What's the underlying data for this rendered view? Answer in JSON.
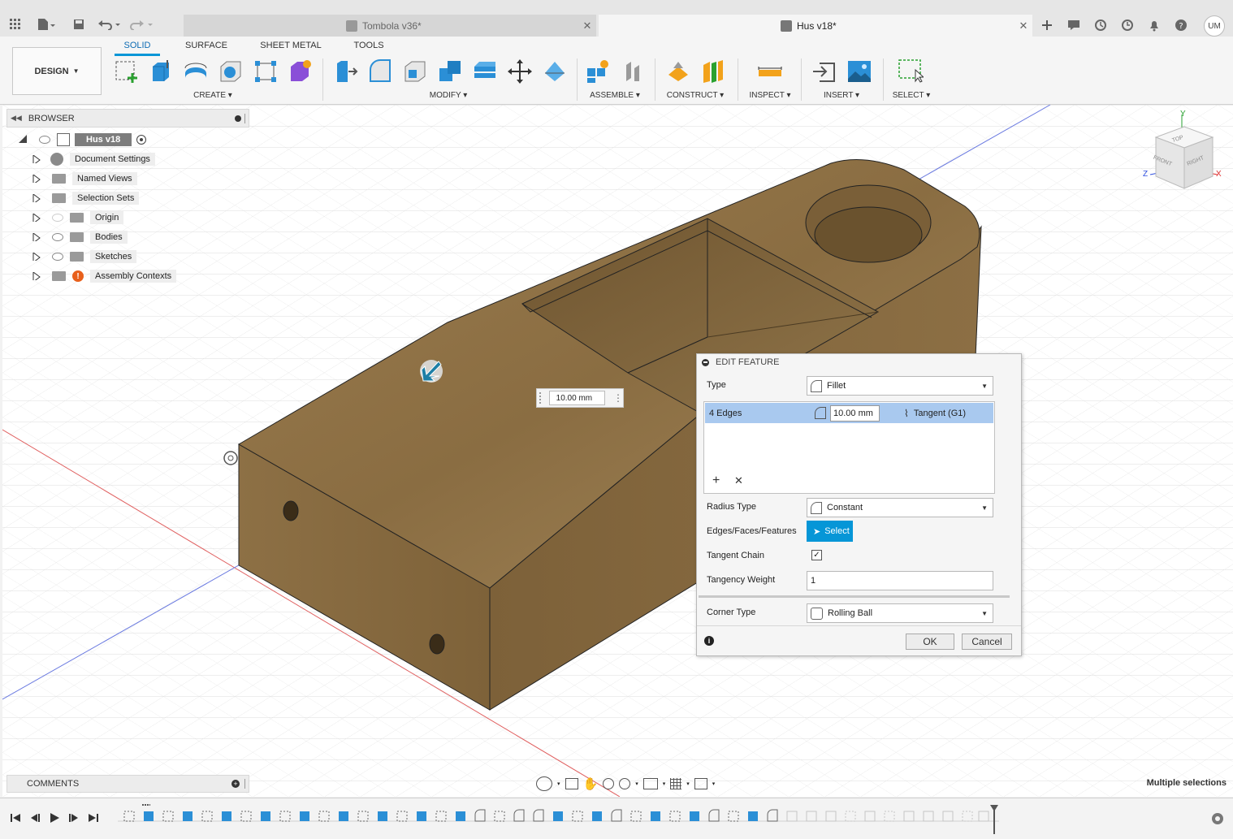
{
  "tabs": [
    {
      "label": "Tombola v36*"
    },
    {
      "label": "Hus v18*"
    }
  ],
  "user": {
    "initials": "UM"
  },
  "design_button": {
    "label": "DESIGN"
  },
  "workspace_tabs": [
    {
      "label": "SOLID"
    },
    {
      "label": "SURFACE"
    },
    {
      "label": "SHEET METAL"
    },
    {
      "label": "TOOLS"
    }
  ],
  "groups": {
    "create": "CREATE",
    "modify": "MODIFY",
    "assemble": "ASSEMBLE",
    "construct": "CONSTRUCT",
    "inspect": "INSPECT",
    "insert": "INSERT",
    "select": "SELECT"
  },
  "browser": {
    "title": "BROWSER",
    "root": "Hus v18",
    "items": [
      {
        "label": "Document Settings",
        "icon": "gear-icon"
      },
      {
        "label": "Named Views",
        "icon": "folder-icon"
      },
      {
        "label": "Selection Sets",
        "icon": "folder-icon"
      },
      {
        "label": "Origin",
        "icon": "folder-icon"
      },
      {
        "label": "Bodies",
        "icon": "folder-icon"
      },
      {
        "label": "Sketches",
        "icon": "folder-icon"
      },
      {
        "label": "Assembly Contexts",
        "icon": "warning-icon"
      }
    ]
  },
  "viewcube": {
    "top": "TOP",
    "front": "FRONT",
    "right": "RIGHT",
    "axis_x": "X",
    "axis_y": "Y",
    "axis_z": "Z"
  },
  "dimension_input": {
    "value": "10.00 mm"
  },
  "comments": {
    "title": "COMMENTS"
  },
  "status": {
    "text": "Multiple selections"
  },
  "dialog": {
    "title": "EDIT FEATURE",
    "type_label": "Type",
    "type_value": "Fillet",
    "edge_row": {
      "label": "4 Edges",
      "radius": "10.00 mm",
      "continuity": "Tangent (G1)"
    },
    "radius_type_label": "Radius Type",
    "radius_type_value": "Constant",
    "edges_label": "Edges/Faces/Features",
    "select_label": "Select",
    "tangent_chain_label": "Tangent Chain",
    "tangency_weight_label": "Tangency Weight",
    "tangency_weight_value": "1",
    "corner_type_label": "Corner Type",
    "corner_type_value": "Rolling Ball",
    "ok_label": "OK",
    "cancel_label": "Cancel"
  },
  "colors": {
    "accent": "#0696d7",
    "wood": "#8f7348",
    "selection": "#a9c9ef"
  }
}
